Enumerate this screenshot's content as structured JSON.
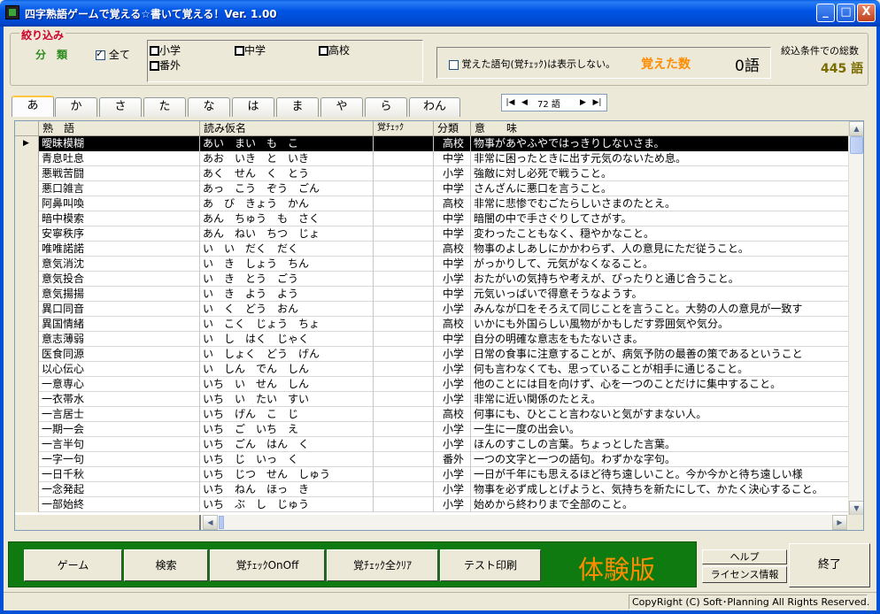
{
  "window": {
    "title": "四字熟語ゲームで覚える☆書いて覚える！Ver. 1.00",
    "buttons": {
      "minimize": "_",
      "maximize": "□",
      "close": "X"
    }
  },
  "filter": {
    "title": "絞り込み",
    "category_label": "分　類",
    "all_label": "全て",
    "all_checked": true,
    "grades": [
      {
        "label": "小学",
        "checked": false
      },
      {
        "label": "中学",
        "checked": false
      },
      {
        "label": "高校",
        "checked": false
      },
      {
        "label": "番外",
        "checked": false
      }
    ],
    "hide_learned_label": "覚えた語句(覚ﾁｪｯｸ)は表示しない。",
    "hide_learned_checked": false,
    "learned_label": "覚えた数",
    "learned_count": "0語",
    "total_label": "絞込条件での総数",
    "total_count": "445 語"
  },
  "tabs": [
    "あ",
    "か",
    "さ",
    "た",
    "な",
    "は",
    "ま",
    "や",
    "ら",
    "わん"
  ],
  "active_tab": 0,
  "nav": {
    "first": "|◀",
    "prev": "◀",
    "count": "72 語",
    "next": "▶",
    "last": "▶|"
  },
  "grid": {
    "columns": [
      "熟　語",
      "読み仮名",
      "覚ﾁｪｯｸ",
      "分類",
      "意　　味"
    ],
    "selected_row": 0,
    "rows": [
      {
        "word": "曖昧模糊",
        "reading": "あい　まい　も　こ",
        "check": "",
        "category": "高校",
        "meaning": "物事があやふやではっきりしないさま。"
      },
      {
        "word": "青息吐息",
        "reading": "あお　いき　と　いき",
        "check": "",
        "category": "中学",
        "meaning": "非常に困ったときに出す元気のないため息。"
      },
      {
        "word": "悪戦苦闘",
        "reading": "あく　せん　く　とう",
        "check": "",
        "category": "小学",
        "meaning": "強敵に対し必死で戦うこと。"
      },
      {
        "word": "悪口雑言",
        "reading": "あっ　こう　ぞう　ごん",
        "check": "",
        "category": "中学",
        "meaning": "さんざんに悪口を言うこと。"
      },
      {
        "word": "阿鼻叫喚",
        "reading": "あ　び　きょう　かん",
        "check": "",
        "category": "高校",
        "meaning": "非常に悲惨でむごたらしいさまのたとえ。"
      },
      {
        "word": "暗中模索",
        "reading": "あん　ちゅう　も　さく",
        "check": "",
        "category": "中学",
        "meaning": "暗闇の中で手さぐりしてさがす。"
      },
      {
        "word": "安寧秩序",
        "reading": "あん　ねい　ちつ　じょ",
        "check": "",
        "category": "中学",
        "meaning": "変わったこともなく、穏やかなこと。"
      },
      {
        "word": "唯唯諾諾",
        "reading": "い　い　だく　だく",
        "check": "",
        "category": "高校",
        "meaning": "物事のよしあしにかかわらず、人の意見にただ従うこと。"
      },
      {
        "word": "意気消沈",
        "reading": "い　き　しょう　ちん",
        "check": "",
        "category": "中学",
        "meaning": "がっかりして、元気がなくなること。"
      },
      {
        "word": "意気投合",
        "reading": "い　き　とう　ごう",
        "check": "",
        "category": "小学",
        "meaning": "おたがいの気持ちや考えが、ぴったりと通じ合うこと。"
      },
      {
        "word": "意気揚揚",
        "reading": "い　き　よう　よう",
        "check": "",
        "category": "中学",
        "meaning": "元気いっぱいで得意そうなようす。"
      },
      {
        "word": "異口同音",
        "reading": "い　く　どう　おん",
        "check": "",
        "category": "小学",
        "meaning": "みんなが口をそろえて同じことを言うこと。大勢の人の意見が一致す"
      },
      {
        "word": "異国情緒",
        "reading": "い　こく　じょう　ちょ",
        "check": "",
        "category": "高校",
        "meaning": "いかにも外国らしい風物がかもしだす雰囲気や気分。"
      },
      {
        "word": "意志薄弱",
        "reading": "い　し　はく　じゃく",
        "check": "",
        "category": "中学",
        "meaning": "自分の明確な意志をもたないさま。"
      },
      {
        "word": "医食同源",
        "reading": "い　しょく　どう　げん",
        "check": "",
        "category": "小学",
        "meaning": "日常の食事に注意することが、病気予防の最善の策であるということ"
      },
      {
        "word": "以心伝心",
        "reading": "い　しん　でん　しん",
        "check": "",
        "category": "小学",
        "meaning": "何も言わなくても、思っていることが相手に通じること。"
      },
      {
        "word": "一意専心",
        "reading": "いち　い　せん　しん",
        "check": "",
        "category": "小学",
        "meaning": "他のことには目を向けず、心を一つのことだけに集中すること。"
      },
      {
        "word": "一衣帯水",
        "reading": "いち　い　たい　すい",
        "check": "",
        "category": "小学",
        "meaning": "非常に近い関係のたとえ。"
      },
      {
        "word": "一言居士",
        "reading": "いち　げん　こ　じ",
        "check": "",
        "category": "高校",
        "meaning": "何事にも、ひとこと言わないと気がすまない人。"
      },
      {
        "word": "一期一会",
        "reading": "いち　ご　いち　え",
        "check": "",
        "category": "小学",
        "meaning": "一生に一度の出会い。"
      },
      {
        "word": "一言半句",
        "reading": "いち　ごん　はん　く",
        "check": "",
        "category": "小学",
        "meaning": "ほんのすこしの言葉。ちょっとした言葉。"
      },
      {
        "word": "一字一句",
        "reading": "いち　じ　いっ　く",
        "check": "",
        "category": "番外",
        "meaning": "一つの文字と一つの語句。わずかな字句。"
      },
      {
        "word": "一日千秋",
        "reading": "いち　じつ　せん　しゅう",
        "check": "",
        "category": "小学",
        "meaning": "一日が千年にも思えるほど待ち遠しいこと。今か今かと待ち遠しい様"
      },
      {
        "word": "一念発起",
        "reading": "いち　ねん　ほっ　き",
        "check": "",
        "category": "小学",
        "meaning": "物事を必ず成しとげようと、気持ちを新たにして、かたく決心すること。"
      },
      {
        "word": "一部始終",
        "reading": "いち　ぶ　し　じゅう",
        "check": "",
        "category": "小学",
        "meaning": "始めから終わりまで全部のこと。"
      }
    ]
  },
  "toolbar": {
    "game": "ゲーム",
    "search": "検索",
    "check_toggle": "覚ﾁｪｯｸOnOff",
    "check_clear": "覚ﾁｪｯｸ全ｸﾘｱ",
    "test_print": "テスト印刷",
    "trial": "体験版",
    "help": "ヘルプ",
    "license": "ライセンス情報",
    "exit": "終了"
  },
  "status": {
    "copyright": "CopyRight (C) Soft･Planning All Rights Reserved."
  }
}
